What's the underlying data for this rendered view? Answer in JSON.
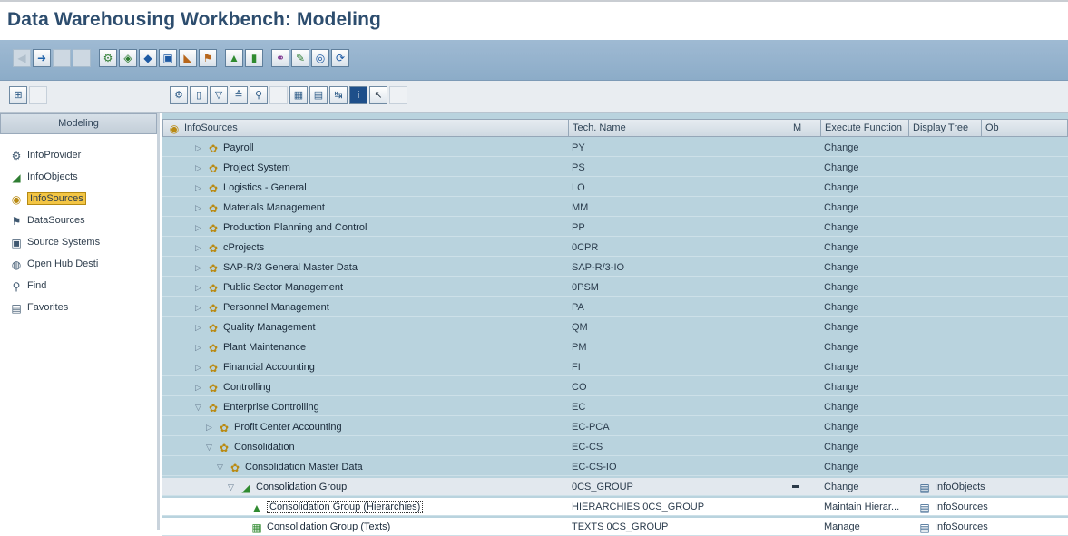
{
  "title": "Data Warehousing Workbench: Modeling",
  "left_panel": {
    "header": "Modeling",
    "items": [
      {
        "label": "InfoProvider",
        "icon": "infoprovider-icon",
        "glyph": "⚙"
      },
      {
        "label": "InfoObjects",
        "icon": "infoobject-icon",
        "glyph": "◢"
      },
      {
        "label": "InfoSources",
        "icon": "infosource-icon",
        "glyph": "◉",
        "active": true
      },
      {
        "label": "DataSources",
        "icon": "datasource-icon",
        "glyph": "⚑"
      },
      {
        "label": "Source Systems",
        "icon": "source-system-icon",
        "glyph": "▣"
      },
      {
        "label": "Open Hub Desti",
        "icon": "open-hub-icon",
        "glyph": "◍"
      },
      {
        "label": "Find",
        "icon": "binoculars-icon",
        "glyph": "⚲"
      },
      {
        "label": "Favorites",
        "icon": "favorites-icon",
        "glyph": "▤"
      }
    ]
  },
  "columns": {
    "name": "InfoSources",
    "tech": "Tech. Name",
    "m": "M",
    "exec": "Execute Function",
    "display": "Display Tree",
    "ob": "Ob"
  },
  "rows": [
    {
      "name": "Payroll",
      "tech": "PY",
      "exec": "Change",
      "level": 0,
      "exp": "▷"
    },
    {
      "name": "Project System",
      "tech": "PS",
      "exec": "Change",
      "level": 0,
      "exp": "▷"
    },
    {
      "name": "Logistics - General",
      "tech": "LO",
      "exec": "Change",
      "level": 0,
      "exp": "▷"
    },
    {
      "name": "Materials Management",
      "tech": "MM",
      "exec": "Change",
      "level": 0,
      "exp": "▷"
    },
    {
      "name": "Production Planning and Control",
      "tech": "PP",
      "exec": "Change",
      "level": 0,
      "exp": "▷"
    },
    {
      "name": "cProjects",
      "tech": "0CPR",
      "exec": "Change",
      "level": 0,
      "exp": "▷"
    },
    {
      "name": "SAP-R/3 General Master Data",
      "tech": "SAP-R/3-IO",
      "exec": "Change",
      "level": 0,
      "exp": "▷"
    },
    {
      "name": "Public Sector Management",
      "tech": "0PSM",
      "exec": "Change",
      "level": 0,
      "exp": "▷"
    },
    {
      "name": "Personnel Management",
      "tech": "PA",
      "exec": "Change",
      "level": 0,
      "exp": "▷"
    },
    {
      "name": "Quality Management",
      "tech": "QM",
      "exec": "Change",
      "level": 0,
      "exp": "▷"
    },
    {
      "name": "Plant Maintenance",
      "tech": "PM",
      "exec": "Change",
      "level": 0,
      "exp": "▷"
    },
    {
      "name": "Financial Accounting",
      "tech": "FI",
      "exec": "Change",
      "level": 0,
      "exp": "▷"
    },
    {
      "name": "Controlling",
      "tech": "CO",
      "exec": "Change",
      "level": 0,
      "exp": "▷"
    },
    {
      "name": "Enterprise Controlling",
      "tech": "EC",
      "exec": "Change",
      "level": 0,
      "exp": "▽"
    },
    {
      "name": "Profit Center Accounting",
      "tech": "EC-PCA",
      "exec": "Change",
      "level": 1,
      "exp": "▷"
    },
    {
      "name": "Consolidation",
      "tech": "EC-CS",
      "exec": "Change",
      "level": 1,
      "exp": "▽"
    },
    {
      "name": "Consolidation Master Data",
      "tech": "EC-CS-IO",
      "exec": "Change",
      "level": 2,
      "exp": "▽"
    },
    {
      "name": "Consolidation Group",
      "tech": "0CS_GROUP",
      "exec": "Change",
      "display": "InfoObjects",
      "level": 3,
      "exp": "▽",
      "kind": "infoobject",
      "highlight": true
    },
    {
      "name": "Consolidation Group (Hierarchies)",
      "tech": "HIERARCHIES 0CS_GROUP",
      "exec": "Maintain Hierar...",
      "display": "InfoSources",
      "level": 4,
      "kind": "hier",
      "selected": true
    },
    {
      "name": "Consolidation Group (Texts)",
      "tech": "TEXTS 0CS_GROUP",
      "exec": "Manage",
      "display": "InfoSources",
      "level": 4,
      "kind": "text"
    }
  ]
}
